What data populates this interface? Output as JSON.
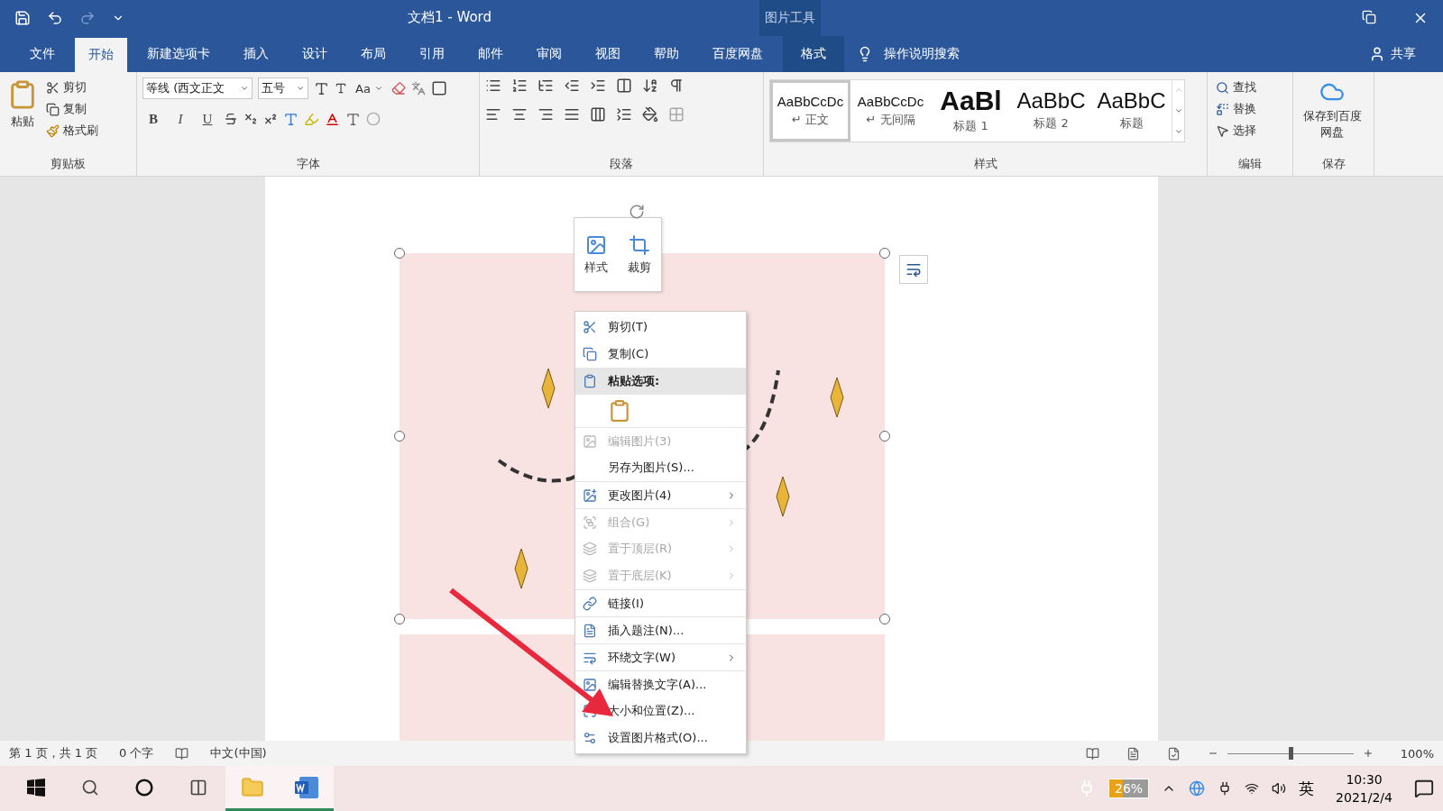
{
  "title_bar": {
    "title": "文档1  -  Word",
    "contextual_group": "图片工具"
  },
  "tabs": [
    {
      "label": "文件",
      "selected": false,
      "kind": "file"
    },
    {
      "label": "开始",
      "selected": true,
      "kind": "normal"
    },
    {
      "label": "新建选项卡",
      "selected": false,
      "kind": "normal"
    },
    {
      "label": "插入",
      "selected": false,
      "kind": "normal"
    },
    {
      "label": "设计",
      "selected": false,
      "kind": "normal"
    },
    {
      "label": "布局",
      "selected": false,
      "kind": "normal"
    },
    {
      "label": "引用",
      "selected": false,
      "kind": "normal"
    },
    {
      "label": "邮件",
      "selected": false,
      "kind": "normal"
    },
    {
      "label": "审阅",
      "selected": false,
      "kind": "normal"
    },
    {
      "label": "视图",
      "selected": false,
      "kind": "normal"
    },
    {
      "label": "帮助",
      "selected": false,
      "kind": "normal"
    },
    {
      "label": "百度网盘",
      "selected": false,
      "kind": "normal"
    },
    {
      "label": "格式",
      "selected": false,
      "kind": "contextual"
    }
  ],
  "tell_me": {
    "placeholder": "操作说明搜索"
  },
  "share": "共享",
  "ribbon": {
    "clipboard": {
      "paste": "粘贴",
      "cut": "剪切",
      "copy": "复制",
      "format_painter": "格式刷",
      "label": "剪贴板"
    },
    "font": {
      "font_name": "等线 (西文正文",
      "font_size": "五号",
      "case_button": "Aa",
      "format_buttons": [
        "B",
        "I",
        "U"
      ],
      "label": "字体"
    },
    "paragraph": {
      "label": "段落"
    },
    "styles": {
      "items": [
        {
          "preview": "AaBbCcDc",
          "name": "↵ 正文",
          "kind": "body",
          "selected": true
        },
        {
          "preview": "AaBbCcDc",
          "name": "↵ 无间隔",
          "kind": "body",
          "selected": false
        },
        {
          "preview": "AaBl",
          "name": "标题 1",
          "kind": "heading1",
          "selected": false
        },
        {
          "preview": "AaBbC",
          "name": "标题 2",
          "kind": "heading2",
          "selected": false
        },
        {
          "preview": "AaBbC",
          "name": "标题",
          "kind": "title",
          "selected": false
        }
      ],
      "label": "样式"
    },
    "editing": {
      "find": "查找",
      "replace": "替换",
      "select": "选择",
      "label": "编辑"
    },
    "save": {
      "button": "保存到百度网盘",
      "label": "保存"
    }
  },
  "mini_toolbar": [
    "样式",
    "裁剪"
  ],
  "context_menu": [
    {
      "label": "剪切(T)",
      "kind": "item",
      "disabled": false,
      "submenu": false,
      "selected": false
    },
    {
      "label": "复制(C)",
      "kind": "item",
      "disabled": false,
      "submenu": false,
      "selected": false
    },
    {
      "label": "粘贴选项:",
      "kind": "header",
      "disabled": false,
      "submenu": false,
      "selected": true
    },
    {
      "kind": "paste_icon",
      "disabled": false,
      "submenu": false,
      "selected": false
    },
    {
      "label": "编辑图片(3)",
      "kind": "item",
      "disabled": true,
      "submenu": false,
      "selected": false
    },
    {
      "label": "另存为图片(S)...",
      "kind": "item",
      "disabled": false,
      "submenu": false,
      "selected": false
    },
    {
      "label": "更改图片(4)",
      "kind": "item",
      "disabled": false,
      "submenu": true,
      "selected": false
    },
    {
      "label": "组合(G)",
      "kind": "item",
      "disabled": true,
      "submenu": true,
      "selected": false
    },
    {
      "label": "置于顶层(R)",
      "kind": "item",
      "disabled": true,
      "submenu": true,
      "selected": false
    },
    {
      "label": "置于底层(K)",
      "kind": "item",
      "disabled": true,
      "submenu": true,
      "selected": false
    },
    {
      "label": "链接(I)",
      "kind": "item",
      "disabled": false,
      "submenu": false,
      "selected": false
    },
    {
      "label": "插入题注(N)...",
      "kind": "item",
      "disabled": false,
      "submenu": false,
      "selected": false
    },
    {
      "label": "环绕文字(W)",
      "kind": "item",
      "disabled": false,
      "submenu": true,
      "selected": false
    },
    {
      "label": "编辑替换文字(A)...",
      "kind": "item",
      "disabled": false,
      "submenu": false,
      "selected": false
    },
    {
      "label": "大小和位置(Z)...",
      "kind": "item",
      "disabled": false,
      "submenu": false,
      "selected": false
    },
    {
      "label": "设置图片格式(O)...",
      "kind": "item",
      "disabled": false,
      "submenu": false,
      "selected": false
    }
  ],
  "status_bar": {
    "page": "第 1 页，共 1 页",
    "words": "0 个字",
    "language": "中文(中国)",
    "zoom": "100%",
    "zoom_slider": {
      "level": 0.5
    }
  },
  "taskbar": {
    "battery": "26%",
    "ime": "英",
    "time": "10:30",
    "date": "2021/2/4"
  }
}
